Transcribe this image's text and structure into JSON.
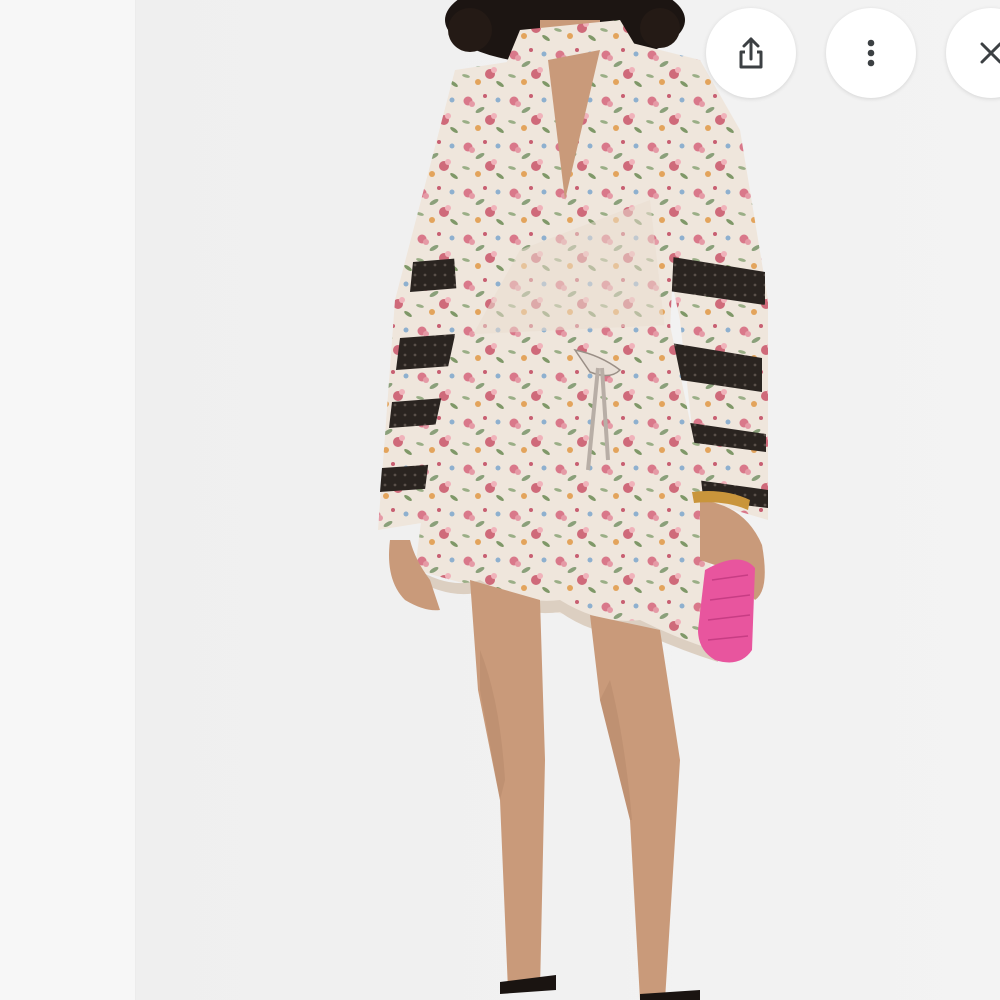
{
  "viewer": {
    "photo": {
      "subject_icon": "model-in-floral-wrap-dress-photo",
      "colors": {
        "background": "#f3f3f3",
        "dress_base": "#efe6dc",
        "lace_trim": "#2a2420",
        "skin": "#c99a7a",
        "clutch": "#e8559e",
        "hair": "#1c1512"
      }
    },
    "toolbar": {
      "share_icon": "share-icon",
      "more_icon": "more-vertical-icon",
      "close_icon": "close-icon"
    }
  }
}
